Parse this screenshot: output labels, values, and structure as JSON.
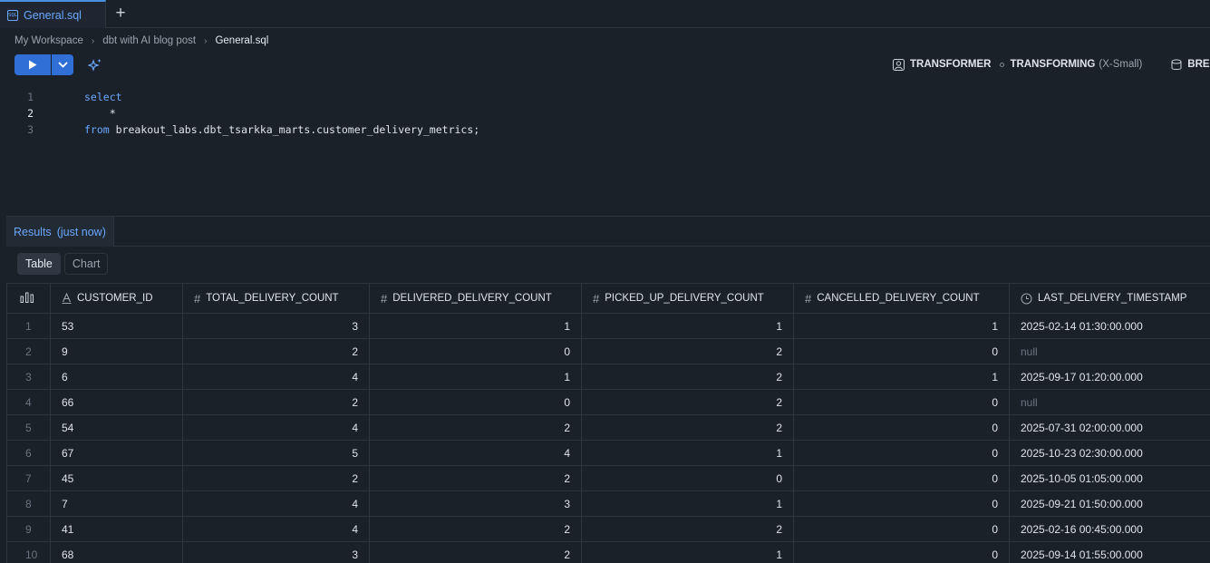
{
  "tabs": [
    {
      "label": "General.sql",
      "icon": "sql-file-icon"
    }
  ],
  "breadcrumb": [
    "My Workspace",
    "dbt with AI blog post",
    "General.sql"
  ],
  "toolbar": {
    "role": "TRANSFORMER",
    "warehouse": "TRANSFORMING",
    "warehouse_size": "(X-Small)",
    "database": "BREAK"
  },
  "editor": {
    "line_numbers": [
      "1",
      "2",
      "3"
    ],
    "lines": [
      {
        "kw": "select",
        "rest": ""
      },
      {
        "kw": "",
        "rest": "    *"
      },
      {
        "kw": "from",
        "rest": " breakout_labs.dbt_tsarkka_marts.customer_delivery_metrics;"
      }
    ]
  },
  "results": {
    "tab_label": "Results",
    "tab_time": "(just now)",
    "views": [
      "Table",
      "Chart"
    ],
    "columns": [
      "CUSTOMER_ID",
      "TOTAL_DELIVERY_COUNT",
      "DELIVERED_DELIVERY_COUNT",
      "PICKED_UP_DELIVERY_COUNT",
      "CANCELLED_DELIVERY_COUNT",
      "LAST_DELIVERY_TIMESTAMP"
    ],
    "column_types": [
      "text",
      "number",
      "number",
      "number",
      "number",
      "timestamp"
    ],
    "rows": [
      [
        "1",
        "53",
        "3",
        "1",
        "1",
        "1",
        "2025-02-14 01:30:00.000"
      ],
      [
        "2",
        "9",
        "2",
        "0",
        "2",
        "0",
        "null"
      ],
      [
        "3",
        "6",
        "4",
        "1",
        "2",
        "1",
        "2025-09-17 01:20:00.000"
      ],
      [
        "4",
        "66",
        "2",
        "0",
        "2",
        "0",
        "null"
      ],
      [
        "5",
        "54",
        "4",
        "2",
        "2",
        "0",
        "2025-07-31 02:00:00.000"
      ],
      [
        "6",
        "67",
        "5",
        "4",
        "1",
        "0",
        "2025-10-23 02:30:00.000"
      ],
      [
        "7",
        "45",
        "2",
        "2",
        "0",
        "0",
        "2025-10-05 01:05:00.000"
      ],
      [
        "8",
        "7",
        "4",
        "3",
        "1",
        "0",
        "2025-09-21 01:50:00.000"
      ],
      [
        "9",
        "41",
        "4",
        "2",
        "2",
        "0",
        "2025-02-16 00:45:00.000"
      ],
      [
        "10",
        "68",
        "3",
        "2",
        "1",
        "0",
        "2025-09-14 01:55:00.000"
      ]
    ]
  },
  "colors": {
    "accent": "#2f6fd6",
    "link": "#6aa8ff",
    "background": "#1b2129"
  }
}
